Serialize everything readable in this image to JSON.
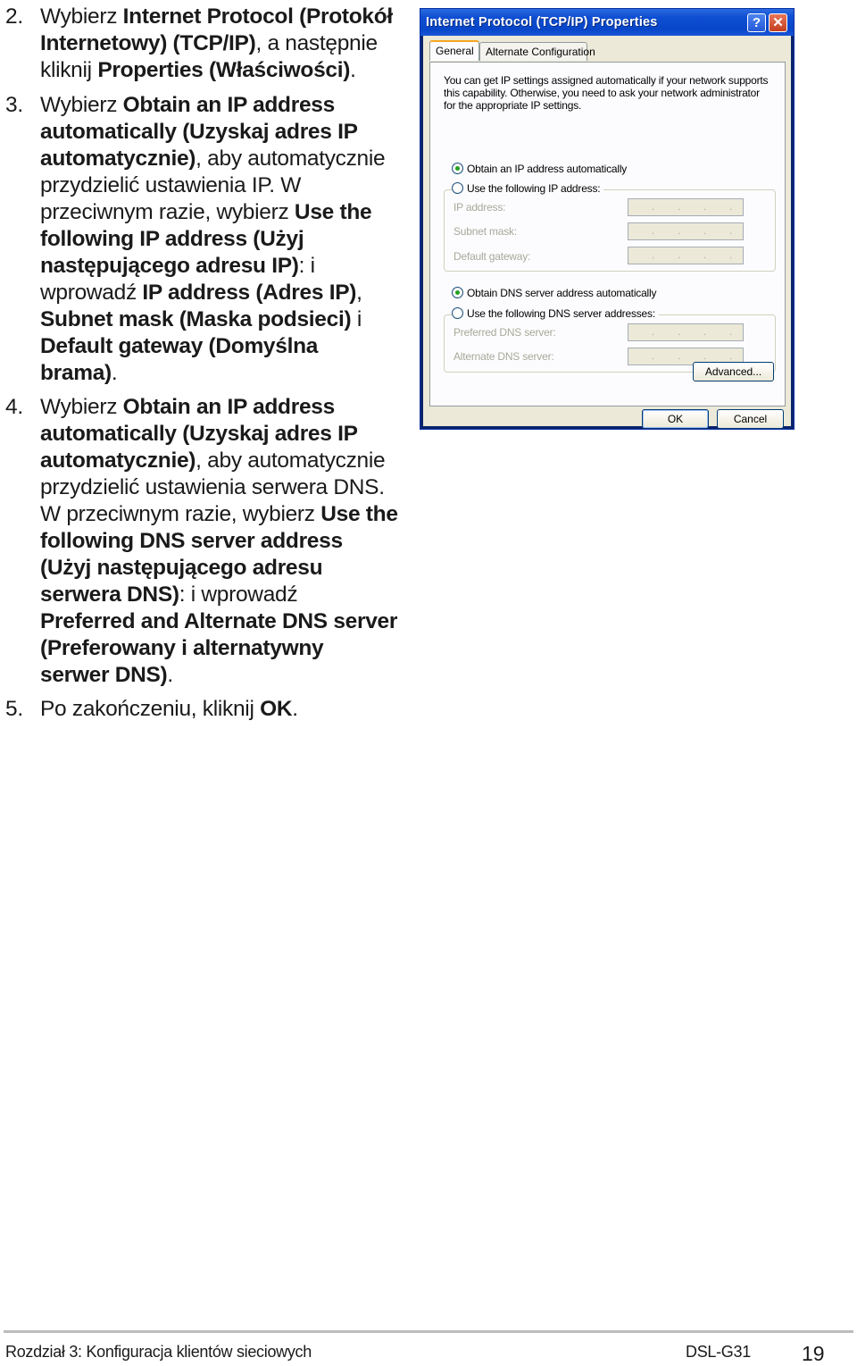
{
  "steps": [
    {
      "number": "2.",
      "segments": [
        {
          "text": "Wybierz ",
          "bold": false
        },
        {
          "text": "Internet Protocol (Protokół Internetowy) (TCP/IP)",
          "bold": true
        },
        {
          "text": ", a następnie kliknij ",
          "bold": false
        },
        {
          "text": "Properties (Właściwości)",
          "bold": true
        },
        {
          "text": ".",
          "bold": false
        }
      ]
    },
    {
      "number": "3.",
      "segments": [
        {
          "text": "Wybierz ",
          "bold": false
        },
        {
          "text": "Obtain an IP address automatically (Uzyskaj adres IP automatycznie)",
          "bold": true
        },
        {
          "text": ", aby automatycznie przydzielić ustawienia IP. W przeciwnym razie, wybierz ",
          "bold": false
        },
        {
          "text": "Use the following IP address (Użyj następującego adresu IP)",
          "bold": true
        },
        {
          "text": ": i wprowadź ",
          "bold": false
        },
        {
          "text": "IP address (Adres IP)",
          "bold": true
        },
        {
          "text": ", ",
          "bold": false
        },
        {
          "text": "Subnet mask (Maska podsieci)",
          "bold": true
        },
        {
          "text": " i ",
          "bold": false
        },
        {
          "text": "Default gateway (Domyślna brama)",
          "bold": true
        },
        {
          "text": ".",
          "bold": false
        }
      ]
    },
    {
      "number": "4.",
      "segments": [
        {
          "text": "Wybierz ",
          "bold": false
        },
        {
          "text": "Obtain an IP address automatically (Uzyskaj adres IP automatycznie)",
          "bold": true
        },
        {
          "text": ", aby automatycznie przydzielić ustawienia serwera DNS. W przeciwnym razie, wybierz ",
          "bold": false
        },
        {
          "text": "Use the following DNS server address (Użyj następującego adresu serwera DNS)",
          "bold": true
        },
        {
          "text": ": i wprowadź ",
          "bold": false
        },
        {
          "text": "Preferred and Alternate DNS server (Preferowany i alternatywny serwer DNS)",
          "bold": true
        },
        {
          "text": ".",
          "bold": false
        }
      ]
    },
    {
      "number": "5.",
      "segments": [
        {
          "text": "Po zakończeniu, kliknij ",
          "bold": false
        },
        {
          "text": "OK",
          "bold": true
        },
        {
          "text": ".",
          "bold": false
        }
      ]
    }
  ],
  "dialog": {
    "title": "Internet Protocol (TCP/IP) Properties",
    "help_glyph": "?",
    "close_glyph": "✕",
    "tabs": [
      {
        "label": "General",
        "active": true
      },
      {
        "label": "Alternate Configuration",
        "active": false
      }
    ],
    "intro": "You can get IP settings assigned automatically if your network supports this capability. Otherwise, you need to ask your network administrator for the appropriate IP settings.",
    "ip_auto_label": "Obtain an IP address automatically",
    "ip_manual_label": "Use the following IP address:",
    "ip_fields": [
      {
        "label": "IP address:",
        "value": " .  .  . "
      },
      {
        "label": "Subnet mask:",
        "value": " .  .  . "
      },
      {
        "label": "Default gateway:",
        "value": " .  .  . "
      }
    ],
    "dns_auto_label": "Obtain DNS server address automatically",
    "dns_manual_label": "Use the following DNS server addresses:",
    "dns_fields": [
      {
        "label": "Preferred DNS server:",
        "value": " .  .  . "
      },
      {
        "label": "Alternate DNS server:",
        "value": " .  .  . "
      }
    ],
    "ip_mode_selected": "auto",
    "dns_mode_selected": "auto",
    "advanced_label": "Advanced...",
    "ok_label": "OK",
    "cancel_label": "Cancel",
    "dot_glyph": "...."
  },
  "footer": {
    "chapter": "Rozdział 3: Konfiguracja klientów sieciowych",
    "model": "DSL-G31",
    "page": "19"
  }
}
